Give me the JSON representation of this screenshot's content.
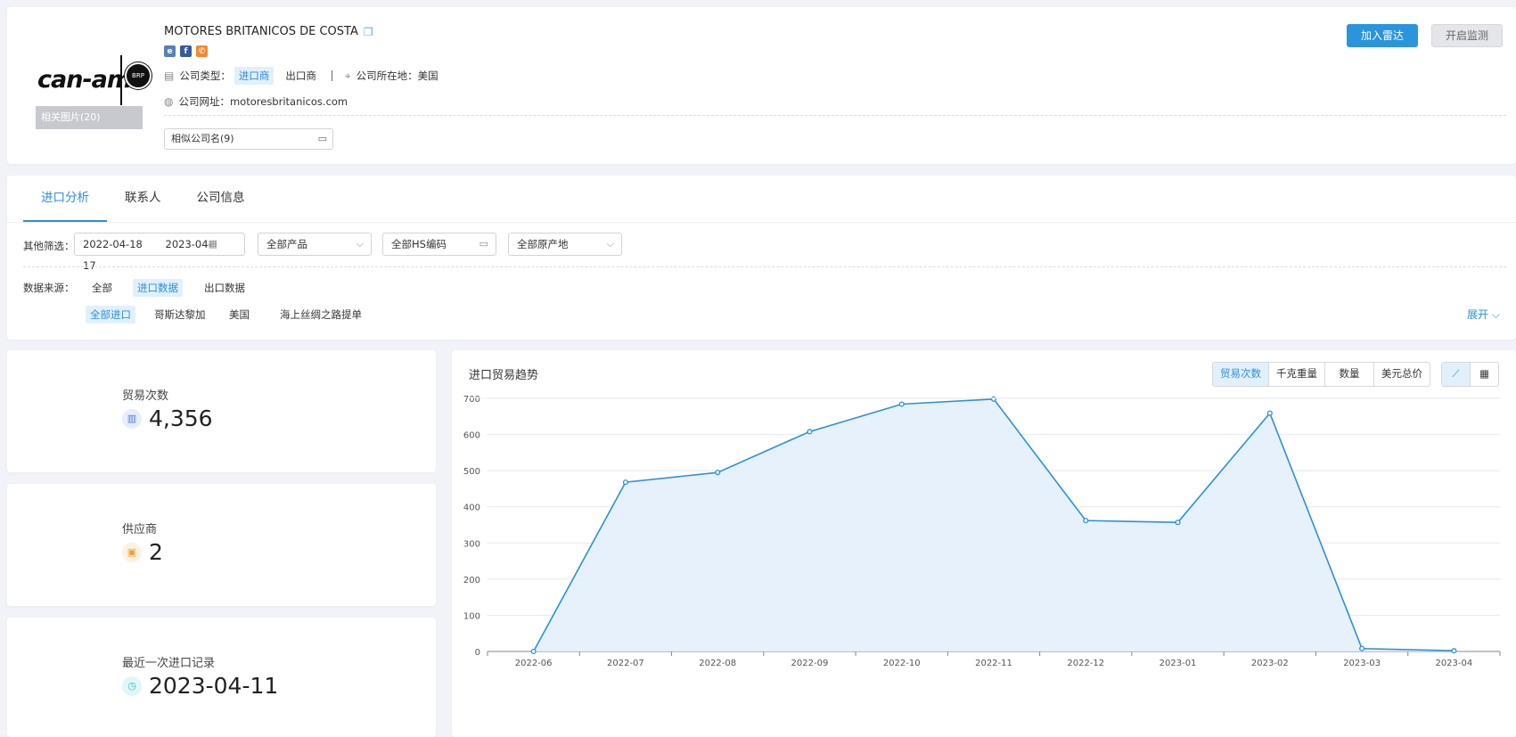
{
  "company": {
    "name": "MOTORES BRITANICOS DE COSTA",
    "logo_text": "can-am",
    "logo_badge": "BRP",
    "related_pics": "相关图片(20)",
    "type_label": "公司类型：",
    "type_active": "进口商",
    "type_other": "出口商",
    "location_label": "公司所在地：",
    "location": "美国",
    "website_label": "公司网址：",
    "website": "motoresbritanicos.com",
    "similar": "相似公司名(9)",
    "btn_radar": "加入雷达",
    "btn_monitor": "开启监测"
  },
  "tabs": [
    "进口分析",
    "联系人",
    "公司信息"
  ],
  "filters": {
    "label": "其他筛选：",
    "date_start": "2022-04-18",
    "date_end": "2023-04-17",
    "product": "全部产品",
    "hs": "全部HS编码",
    "origin": "全部原产地"
  },
  "source": {
    "label": "数据来源：",
    "options": [
      "全部",
      "进口数据",
      "出口数据"
    ],
    "sub": [
      "全部进口",
      "哥斯达黎加",
      "美国",
      "海上丝绸之路提单"
    ],
    "expand": "展开"
  },
  "stats": [
    {
      "label": "贸易次数",
      "value": "4,356",
      "icon": "bar-chart-icon",
      "color": "#4a7bd0"
    },
    {
      "label": "供应商",
      "value": "2",
      "icon": "store-icon",
      "color": "#e8a03b"
    },
    {
      "label": "最近一次进口记录",
      "value": "2023-04-11",
      "icon": "clock-icon",
      "color": "#39b8c9"
    }
  ],
  "chart": {
    "title": "进口贸易趋势",
    "metrics": [
      "贸易次数",
      "千克重量",
      "数量",
      "美元总价"
    ],
    "active_metric": "贸易次数",
    "line_color": "#2e8fd6",
    "fill_color": "#e3f0fb"
  },
  "chart_data": {
    "type": "area",
    "categories": [
      "2022-06",
      "2022-07",
      "2022-08",
      "2022-09",
      "2022-10",
      "2022-11",
      "2022-12",
      "2023-01",
      "2023-02",
      "2023-03",
      "2023-04"
    ],
    "values": [
      0,
      468,
      495,
      608,
      684,
      698,
      362,
      357,
      659,
      8,
      2
    ],
    "yticks": [
      0,
      100,
      200,
      300,
      400,
      500,
      600,
      700
    ],
    "ylim": [
      0,
      700
    ],
    "grid": true
  }
}
